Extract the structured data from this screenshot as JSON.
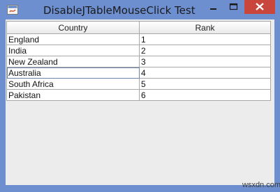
{
  "window": {
    "title": "DisableJTableMouseClick Test",
    "icons": {
      "app": "java-app-icon",
      "minimize": "minimize-icon",
      "maximize": "maximize-icon",
      "close": "close-icon"
    },
    "colors": {
      "titlebar": "#6d8fd0",
      "close_button": "#c9463d",
      "client_bg": "#ececec"
    }
  },
  "table": {
    "columns": [
      "Country",
      "Rank"
    ],
    "rows": [
      [
        "England",
        "1"
      ],
      [
        "India",
        "2"
      ],
      [
        "New Zealand",
        "3"
      ],
      [
        "Australia",
        "4"
      ],
      [
        "South Africa",
        "5"
      ],
      [
        "Pakistan",
        "6"
      ]
    ]
  },
  "watermark": "wsxdn.com"
}
